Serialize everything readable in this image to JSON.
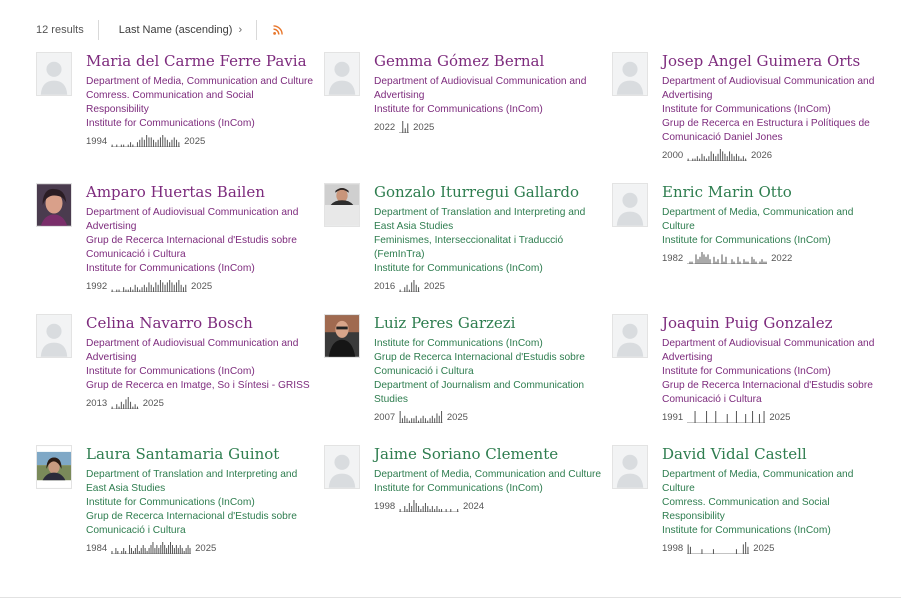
{
  "toolbar": {
    "results": "12 results",
    "sort_label": "Last Name (ascending)",
    "sort_chevron": "›",
    "rss_icon": "rss-icon"
  },
  "colors": {
    "purple": "#7d2b7d",
    "green": "#2e7d4f"
  },
  "people": [
    {
      "name": "Maria del Carme Ferre Pavia",
      "color": "purple",
      "photo": "placeholder",
      "orgs": [
        "Department of Media, Communication and Culture",
        "Comress. Communication and Social Responsibility",
        "Institute for Communications (InCom)"
      ],
      "start": "1994",
      "end": "2025",
      "activity": [
        1,
        0,
        1,
        0,
        1,
        1,
        0,
        1,
        2,
        1,
        0,
        2,
        3,
        4,
        3,
        5,
        4,
        4,
        3,
        2,
        3,
        4,
        5,
        4,
        3,
        2,
        3,
        4,
        3,
        2
      ]
    },
    {
      "name": "Gemma Gómez Bernal",
      "color": "purple",
      "photo": "placeholder",
      "orgs": [
        "Department of Audiovisual Communication and Advertising",
        "Institute for Communications (InCom)"
      ],
      "start": "2022",
      "end": "2025",
      "activity": [
        0,
        5,
        2,
        4
      ]
    },
    {
      "name": "Josep Angel Guimera Orts",
      "color": "purple",
      "photo": "placeholder",
      "orgs": [
        "Department of Audiovisual Communication and Advertising",
        "Institute for Communications (InCom)",
        "Grup de Recerca en Estructura i Polítiques de Comunicació Daniel Jones"
      ],
      "start": "2000",
      "end": "2026",
      "activity": [
        1,
        0,
        1,
        1,
        2,
        1,
        3,
        2,
        1,
        2,
        4,
        3,
        2,
        3,
        5,
        4,
        3,
        2,
        4,
        3,
        2,
        3,
        2,
        1,
        2,
        1
      ]
    },
    {
      "name": "Amparo Huertas Bailen",
      "color": "purple",
      "photo": "woman1",
      "orgs": [
        "Department of Audiovisual Communication and Advertising",
        "Grup de Recerca Internacional d'Estudis sobre Comunicació i Cultura",
        "Institute for Communications (InCom)"
      ],
      "start": "1992",
      "end": "2025",
      "activity": [
        1,
        0,
        1,
        1,
        0,
        2,
        1,
        1,
        2,
        1,
        3,
        2,
        1,
        2,
        3,
        2,
        4,
        3,
        2,
        4,
        3,
        5,
        4,
        3,
        4,
        5,
        4,
        3,
        4,
        5,
        3,
        2,
        3
      ]
    },
    {
      "name": "Gonzalo Iturregui Gallardo",
      "color": "green",
      "photo": "man1",
      "orgs": [
        "Department of Translation and Interpreting and East Asia Studies",
        "Feminismes, Interseccionalitat i Traducció (FemInTra)",
        "Institute for Communications (InCom)"
      ],
      "start": "2016",
      "end": "2025",
      "activity": [
        1,
        0,
        2,
        3,
        1,
        4,
        5,
        3,
        2
      ]
    },
    {
      "name": "Enric Marin Otto",
      "color": "green",
      "photo": "placeholder",
      "orgs": [
        "Department of Media, Communication and Culture",
        "Institute for Communications (InCom)"
      ],
      "start": "1982",
      "end": "2022",
      "activity": [
        0,
        1,
        1,
        0,
        4,
        2,
        3,
        5,
        4,
        3,
        4,
        2,
        0,
        3,
        1,
        2,
        0,
        4,
        1,
        3,
        0,
        0,
        2,
        1,
        0,
        3,
        1,
        0,
        2,
        1,
        1,
        0,
        3,
        2,
        1,
        0,
        1,
        2,
        1,
        1
      ]
    },
    {
      "name": "Celina Navarro Bosch",
      "color": "purple",
      "photo": "placeholder",
      "orgs": [
        "Department of Audiovisual Communication and Advertising",
        "Institute for Communications (InCom)",
        "Grup de Recerca en Imatge, So i Síntesi - GRISS"
      ],
      "start": "2013",
      "end": "2025",
      "activity": [
        1,
        0,
        2,
        1,
        3,
        2,
        4,
        5,
        3,
        1,
        2,
        1
      ]
    },
    {
      "name": "Luiz Peres Garzezi",
      "color": "green",
      "photo": "man2",
      "orgs": [
        "Institute for Communications (InCom)",
        "Grup de Recerca Internacional d'Estudis sobre Comunicació i Cultura",
        "Department of Journalism and Communication Studies"
      ],
      "start": "2007",
      "end": "2025",
      "activity": [
        5,
        2,
        3,
        2,
        1,
        2,
        2,
        3,
        1,
        2,
        3,
        2,
        1,
        2,
        3,
        2,
        4,
        3,
        5
      ]
    },
    {
      "name": "Joaquin Puig Gonzalez",
      "color": "purple",
      "photo": "placeholder",
      "orgs": [
        "Department of Audiovisual Communication and Advertising",
        "Institute for Communications (InCom)",
        "Grup de Recerca Internacional d'Estudis sobre Comunicació i Cultura"
      ],
      "start": "1991",
      "end": "2025",
      "activity": [
        0,
        0,
        0,
        4,
        0,
        0,
        0,
        0,
        4,
        0,
        0,
        0,
        4,
        0,
        0,
        0,
        0,
        3,
        0,
        0,
        0,
        4,
        0,
        0,
        0,
        3,
        0,
        0,
        4,
        0,
        0,
        3,
        0,
        4
      ]
    },
    {
      "name": "Laura Santamaria Guinot",
      "color": "green",
      "photo": "woman2",
      "orgs": [
        "Department of Translation and Interpreting and East Asia Studies",
        "Institute for Communications (InCom)",
        "Grup de Recerca Internacional d'Estudis sobre Comunicació i Cultura"
      ],
      "start": "1984",
      "end": "2025",
      "activity": [
        1,
        0,
        2,
        1,
        0,
        1,
        2,
        1,
        0,
        3,
        2,
        1,
        2,
        3,
        1,
        2,
        3,
        2,
        1,
        2,
        3,
        4,
        2,
        3,
        2,
        3,
        4,
        3,
        2,
        3,
        4,
        3,
        2,
        3,
        2,
        3,
        2,
        1,
        2,
        3,
        2
      ]
    },
    {
      "name": "Jaime Soriano Clemente",
      "color": "green",
      "photo": "placeholder",
      "orgs": [
        "Department of Media, Communication and Culture",
        "Institute for Communications (InCom)"
      ],
      "start": "1998",
      "end": "2024",
      "activity": [
        1,
        0,
        2,
        1,
        3,
        2,
        4,
        3,
        2,
        1,
        2,
        3,
        2,
        1,
        2,
        1,
        2,
        1,
        1,
        0,
        1,
        0,
        1,
        0,
        0,
        1
      ]
    },
    {
      "name": "David Vidal Castell",
      "color": "green",
      "photo": "placeholder",
      "orgs": [
        "Department of Media, Communication and Culture",
        "Comress. Communication and Social Responsibility",
        "Institute for Communications (InCom)"
      ],
      "start": "1998",
      "end": "2025",
      "activity": [
        4,
        3,
        0,
        0,
        0,
        0,
        2,
        0,
        0,
        0,
        0,
        2,
        0,
        0,
        0,
        0,
        0,
        0,
        0,
        0,
        0,
        2,
        0,
        0,
        4,
        5,
        3
      ]
    }
  ]
}
